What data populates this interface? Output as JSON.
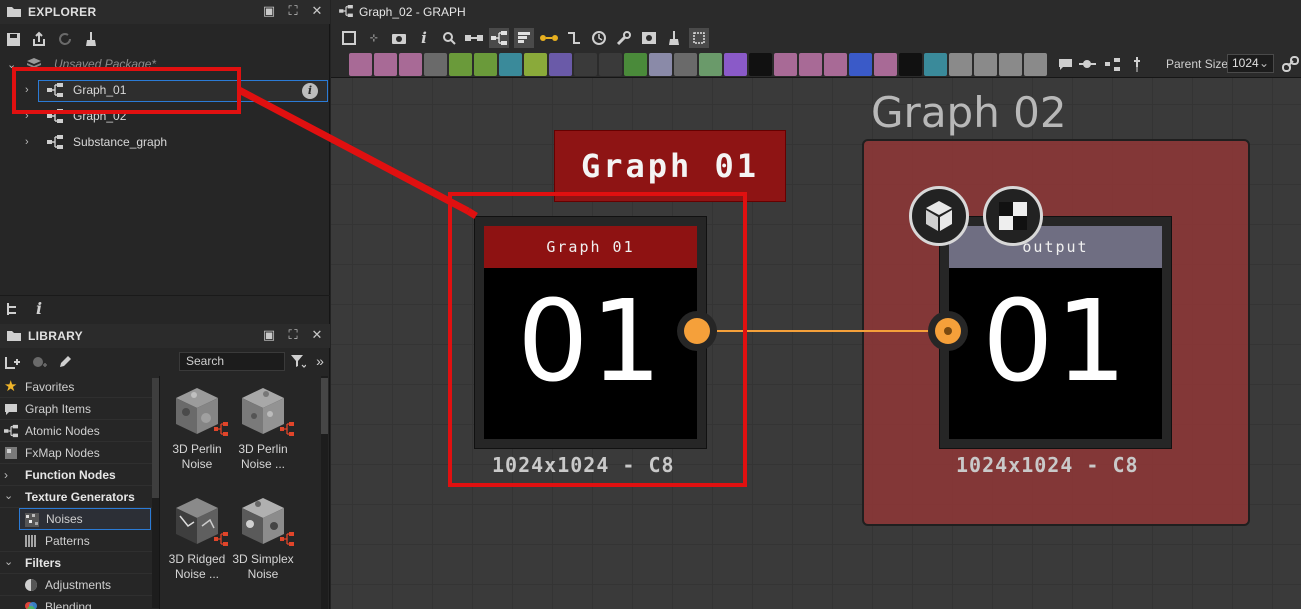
{
  "explorer": {
    "title": "EXPLORER",
    "package_label": "Unsaved Package*",
    "items": [
      {
        "label": "Graph_01"
      },
      {
        "label": "Graph_02"
      },
      {
        "label": "Substance_graph"
      }
    ]
  },
  "library": {
    "title": "LIBRARY",
    "search_placeholder": "Search",
    "categories": [
      {
        "label": "Favorites"
      },
      {
        "label": "Graph Items"
      },
      {
        "label": "Atomic Nodes"
      },
      {
        "label": "FxMap Nodes"
      },
      {
        "label": "Function Nodes"
      },
      {
        "label": "Texture Generators"
      },
      {
        "label": "Noises"
      },
      {
        "label": "Patterns"
      },
      {
        "label": "Filters"
      },
      {
        "label": "Adjustments"
      },
      {
        "label": "Blending"
      }
    ],
    "tiles": [
      {
        "label_1": "3D Perlin",
        "label_2": "Noise"
      },
      {
        "label_1": "3D Perlin",
        "label_2": "Noise ..."
      },
      {
        "label_1": "3D Ridged",
        "label_2": "Noise ..."
      },
      {
        "label_1": "3D Simplex",
        "label_2": "Noise"
      }
    ]
  },
  "graph": {
    "tab_title": "Graph_02 - GRAPH",
    "parent_size_label": "Parent Size:",
    "parent_size_value": "1024",
    "frame_title": "Graph 02",
    "callout_label": "Graph 01",
    "node_left": {
      "header": "Graph 01",
      "thumb_text": "01",
      "resolution": "1024x1024 - C8",
      "header_color": "#8e1212"
    },
    "node_right": {
      "header": "output",
      "thumb_text": "01",
      "resolution": "1024x1024 - C8",
      "header_color": "#6f6e82"
    }
  },
  "colors": {
    "accent_blue": "#2b7bd6",
    "callout_red": "#e01010",
    "wire_orange": "#f5a03a",
    "frame_red": "#963737"
  }
}
